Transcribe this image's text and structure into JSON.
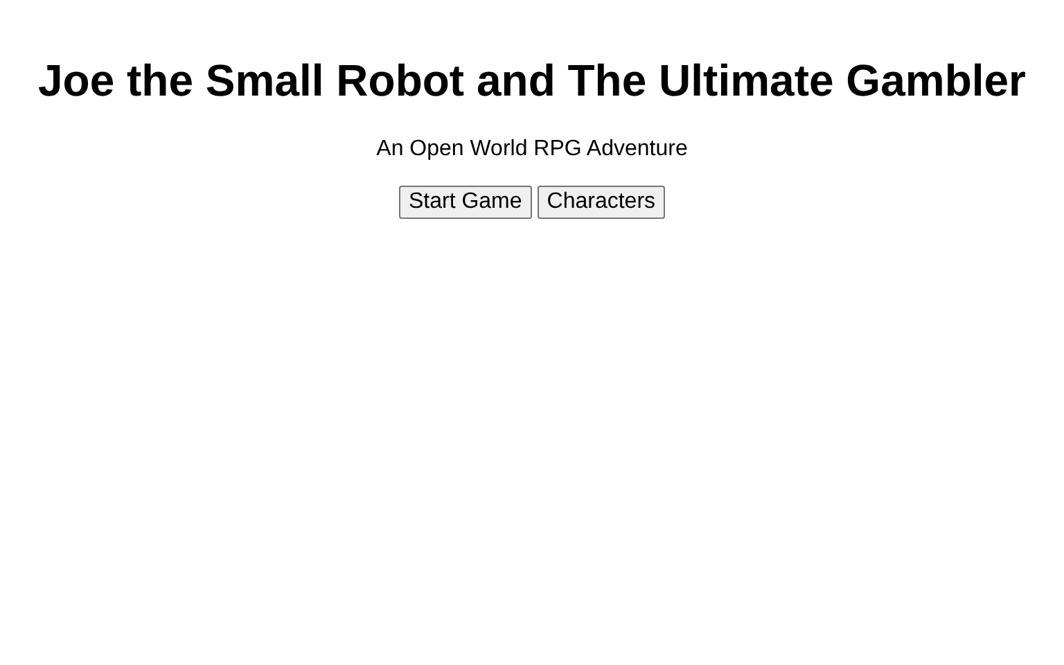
{
  "title": "Joe the Small Robot and The Ultimate Gambler",
  "subtitle": "An Open World RPG Adventure",
  "buttons": [
    "Start Game",
    "Characters"
  ]
}
